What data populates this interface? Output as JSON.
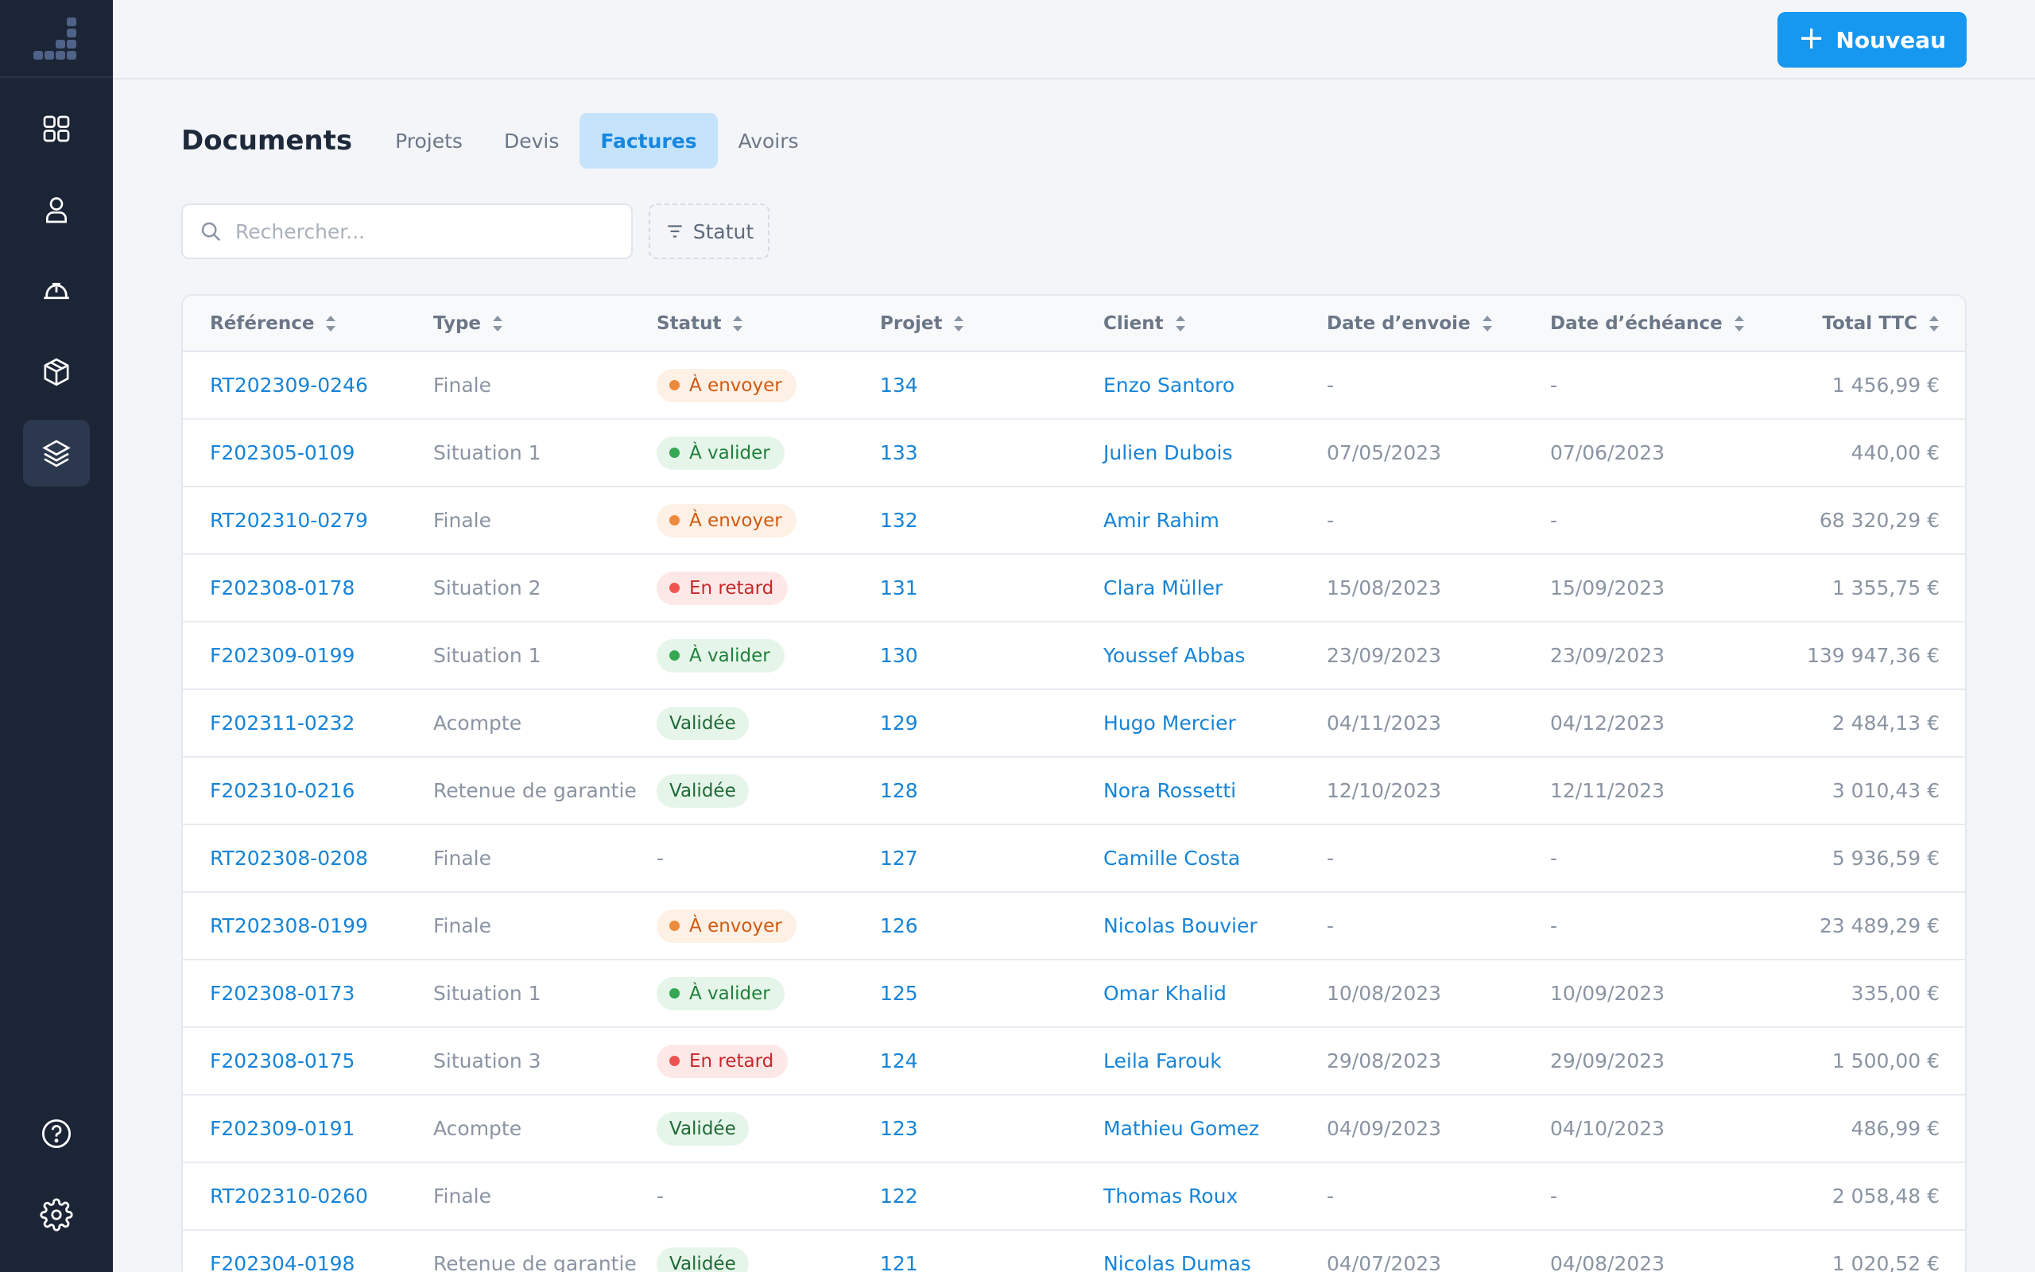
{
  "header": {
    "new_button_label": "Nouveau"
  },
  "page": {
    "title": "Documents"
  },
  "tabs": [
    {
      "label": "Projets",
      "active": false
    },
    {
      "label": "Devis",
      "active": false
    },
    {
      "label": "Factures",
      "active": true
    },
    {
      "label": "Avoirs",
      "active": false
    }
  ],
  "search": {
    "placeholder": "Rechercher...",
    "value": ""
  },
  "filter": {
    "label": "Statut"
  },
  "sidebar": {
    "items": [
      {
        "icon": "grid-icon"
      },
      {
        "icon": "user-icon"
      },
      {
        "icon": "hardhat-icon"
      },
      {
        "icon": "box-icon"
      },
      {
        "icon": "layers-icon",
        "active": true
      }
    ],
    "bottom": [
      {
        "icon": "help-icon"
      },
      {
        "icon": "gear-icon"
      }
    ]
  },
  "table": {
    "columns": [
      "Référence",
      "Type",
      "Statut",
      "Projet",
      "Client",
      "Date d’envoie",
      "Date d’échéance",
      "Total TTC"
    ],
    "rows": [
      {
        "ref": "RT202309-0246",
        "type": "Finale",
        "status": "À envoyer",
        "status_kind": "orange",
        "projet": "134",
        "client": "Enzo Santoro",
        "envoi": "-",
        "echeance": "-",
        "total": "1 456,99 €"
      },
      {
        "ref": "F202305-0109",
        "type": "Situation 1",
        "status": "À valider",
        "status_kind": "green",
        "projet": "133",
        "client": "Julien Dubois",
        "envoi": "07/05/2023",
        "echeance": "07/06/2023",
        "total": "440,00 €"
      },
      {
        "ref": "RT202310-0279",
        "type": "Finale",
        "status": "À envoyer",
        "status_kind": "orange",
        "projet": "132",
        "client": "Amir Rahim",
        "envoi": "-",
        "echeance": "-",
        "total": "68 320,29 €"
      },
      {
        "ref": "F202308-0178",
        "type": "Situation 2",
        "status": "En retard",
        "status_kind": "red",
        "projet": "131",
        "client": "Clara Müller",
        "envoi": "15/08/2023",
        "echeance": "15/09/2023",
        "total": "1 355,75 €"
      },
      {
        "ref": "F202309-0199",
        "type": "Situation 1",
        "status": "À valider",
        "status_kind": "green",
        "projet": "130",
        "client": "Youssef Abbas",
        "envoi": "23/09/2023",
        "echeance": "23/09/2023",
        "total": "139 947,36 €"
      },
      {
        "ref": "F202311-0232",
        "type": "Acompte",
        "status": "Validée",
        "status_kind": "valid",
        "projet": "129",
        "client": "Hugo Mercier",
        "envoi": "04/11/2023",
        "echeance": "04/12/2023",
        "total": "2 484,13 €"
      },
      {
        "ref": "F202310-0216",
        "type": "Retenue de garantie",
        "status": "Validée",
        "status_kind": "valid",
        "projet": "128",
        "client": "Nora Rossetti",
        "envoi": "12/10/2023",
        "echeance": "12/11/2023",
        "total": "3 010,43 €"
      },
      {
        "ref": "RT202308-0208",
        "type": "Finale",
        "status": "-",
        "status_kind": "none",
        "projet": "127",
        "client": "Camille Costa",
        "envoi": "-",
        "echeance": "-",
        "total": "5 936,59 €"
      },
      {
        "ref": "RT202308-0199",
        "type": "Finale",
        "status": "À envoyer",
        "status_kind": "orange",
        "projet": "126",
        "client": "Nicolas Bouvier",
        "envoi": "-",
        "echeance": "-",
        "total": "23 489,29 €"
      },
      {
        "ref": "F202308-0173",
        "type": "Situation 1",
        "status": "À valider",
        "status_kind": "green",
        "projet": "125",
        "client": "Omar Khalid",
        "envoi": "10/08/2023",
        "echeance": "10/09/2023",
        "total": "335,00 €"
      },
      {
        "ref": "F202308-0175",
        "type": "Situation 3",
        "status": "En retard",
        "status_kind": "red",
        "projet": "124",
        "client": "Leila Farouk",
        "envoi": "29/08/2023",
        "echeance": "29/09/2023",
        "total": "1 500,00 €"
      },
      {
        "ref": "F202309-0191",
        "type": "Acompte",
        "status": "Validée",
        "status_kind": "valid",
        "projet": "123",
        "client": "Mathieu Gomez",
        "envoi": "04/09/2023",
        "echeance": "04/10/2023",
        "total": "486,99 €"
      },
      {
        "ref": "RT202310-0260",
        "type": "Finale",
        "status": "-",
        "status_kind": "none",
        "projet": "122",
        "client": "Thomas Roux",
        "envoi": "-",
        "echeance": "-",
        "total": "2 058,48 €"
      },
      {
        "ref": "F202304-0198",
        "type": "Retenue de garantie",
        "status": "Validée",
        "status_kind": "valid",
        "projet": "121",
        "client": "Nicolas Dumas",
        "envoi": "04/07/2023",
        "echeance": "04/08/2023",
        "total": "1 020,52 €"
      }
    ]
  },
  "colors": {
    "accent": "#1697f0",
    "sidebar": "#1c2536",
    "link": "#1684d8"
  }
}
